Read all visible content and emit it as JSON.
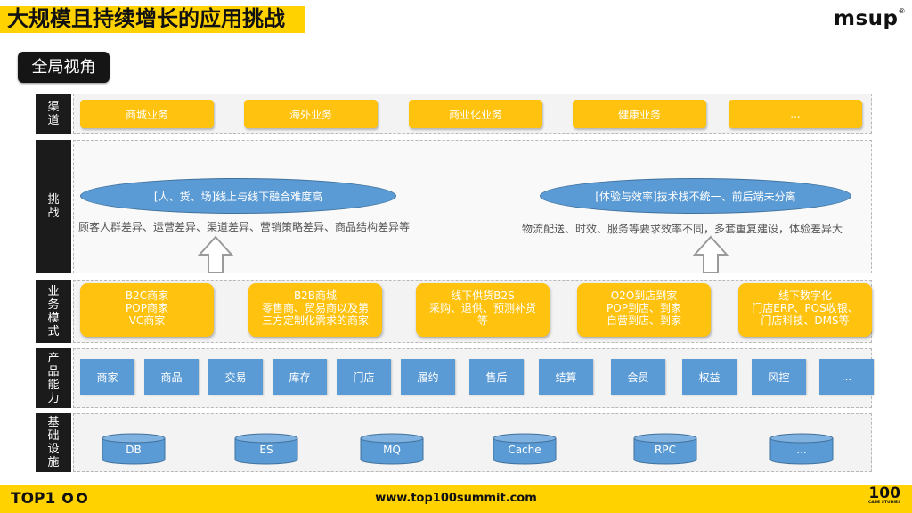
{
  "title": "大规模且持续增长的应用挑战",
  "brand_logo": "msup",
  "brand_mark": "®",
  "global_view": "全局视角",
  "rows": {
    "channels_label": "渠道",
    "challenges_label": "挑战",
    "business_label": "业务模式",
    "product_label": "产品能力",
    "infra_label": "基础设施"
  },
  "channels": [
    "商城业务",
    "海外业务",
    "商业化业务",
    "健康业务",
    "..."
  ],
  "challenges": [
    {
      "title": "[人、货、场]线上与线下融合难度高",
      "detail": "顾客人群差异、运营差异、渠道差异、营销策略差异、商品结构差异等"
    },
    {
      "title": "[体验与效率]技术栈不统一、前后端未分离",
      "detail": "物流配送、时效、服务等要求效率不同，多套重复建设，体验差异大"
    }
  ],
  "business_models": [
    {
      "lines": [
        "B2C商家",
        "POP商家",
        "VC商家"
      ]
    },
    {
      "lines": [
        "B2B商城",
        "零售商、贸易商以及第",
        "三方定制化需求的商家"
      ]
    },
    {
      "lines": [
        "线下供货B2S",
        "采购、退供、预测补货",
        "等"
      ]
    },
    {
      "lines": [
        "O2O到店到家",
        "POP到店、到家",
        "自营到店、到家"
      ]
    },
    {
      "lines": [
        "线下数字化",
        "门店ERP、POS收银、",
        "门店科技、DMS等"
      ]
    }
  ],
  "product_capabilities": [
    "商家",
    "商品",
    "交易",
    "库存",
    "门店",
    "履约",
    "售后",
    "结算",
    "会员",
    "权益",
    "风控",
    "..."
  ],
  "infrastructure": [
    "DB",
    "ES",
    "MQ",
    "Cache",
    "RPC",
    "..."
  ],
  "footer": {
    "left_logo": "TOP1",
    "url": "www.top100summit.com",
    "right_logo": "100",
    "right_logo_sub": "CASE STUDIES"
  },
  "colors": {
    "highlight": "#ffd200",
    "yellow_box": "#ffc20e",
    "blue_box": "#5b9bd5",
    "label_bg": "#1b1b1b"
  }
}
